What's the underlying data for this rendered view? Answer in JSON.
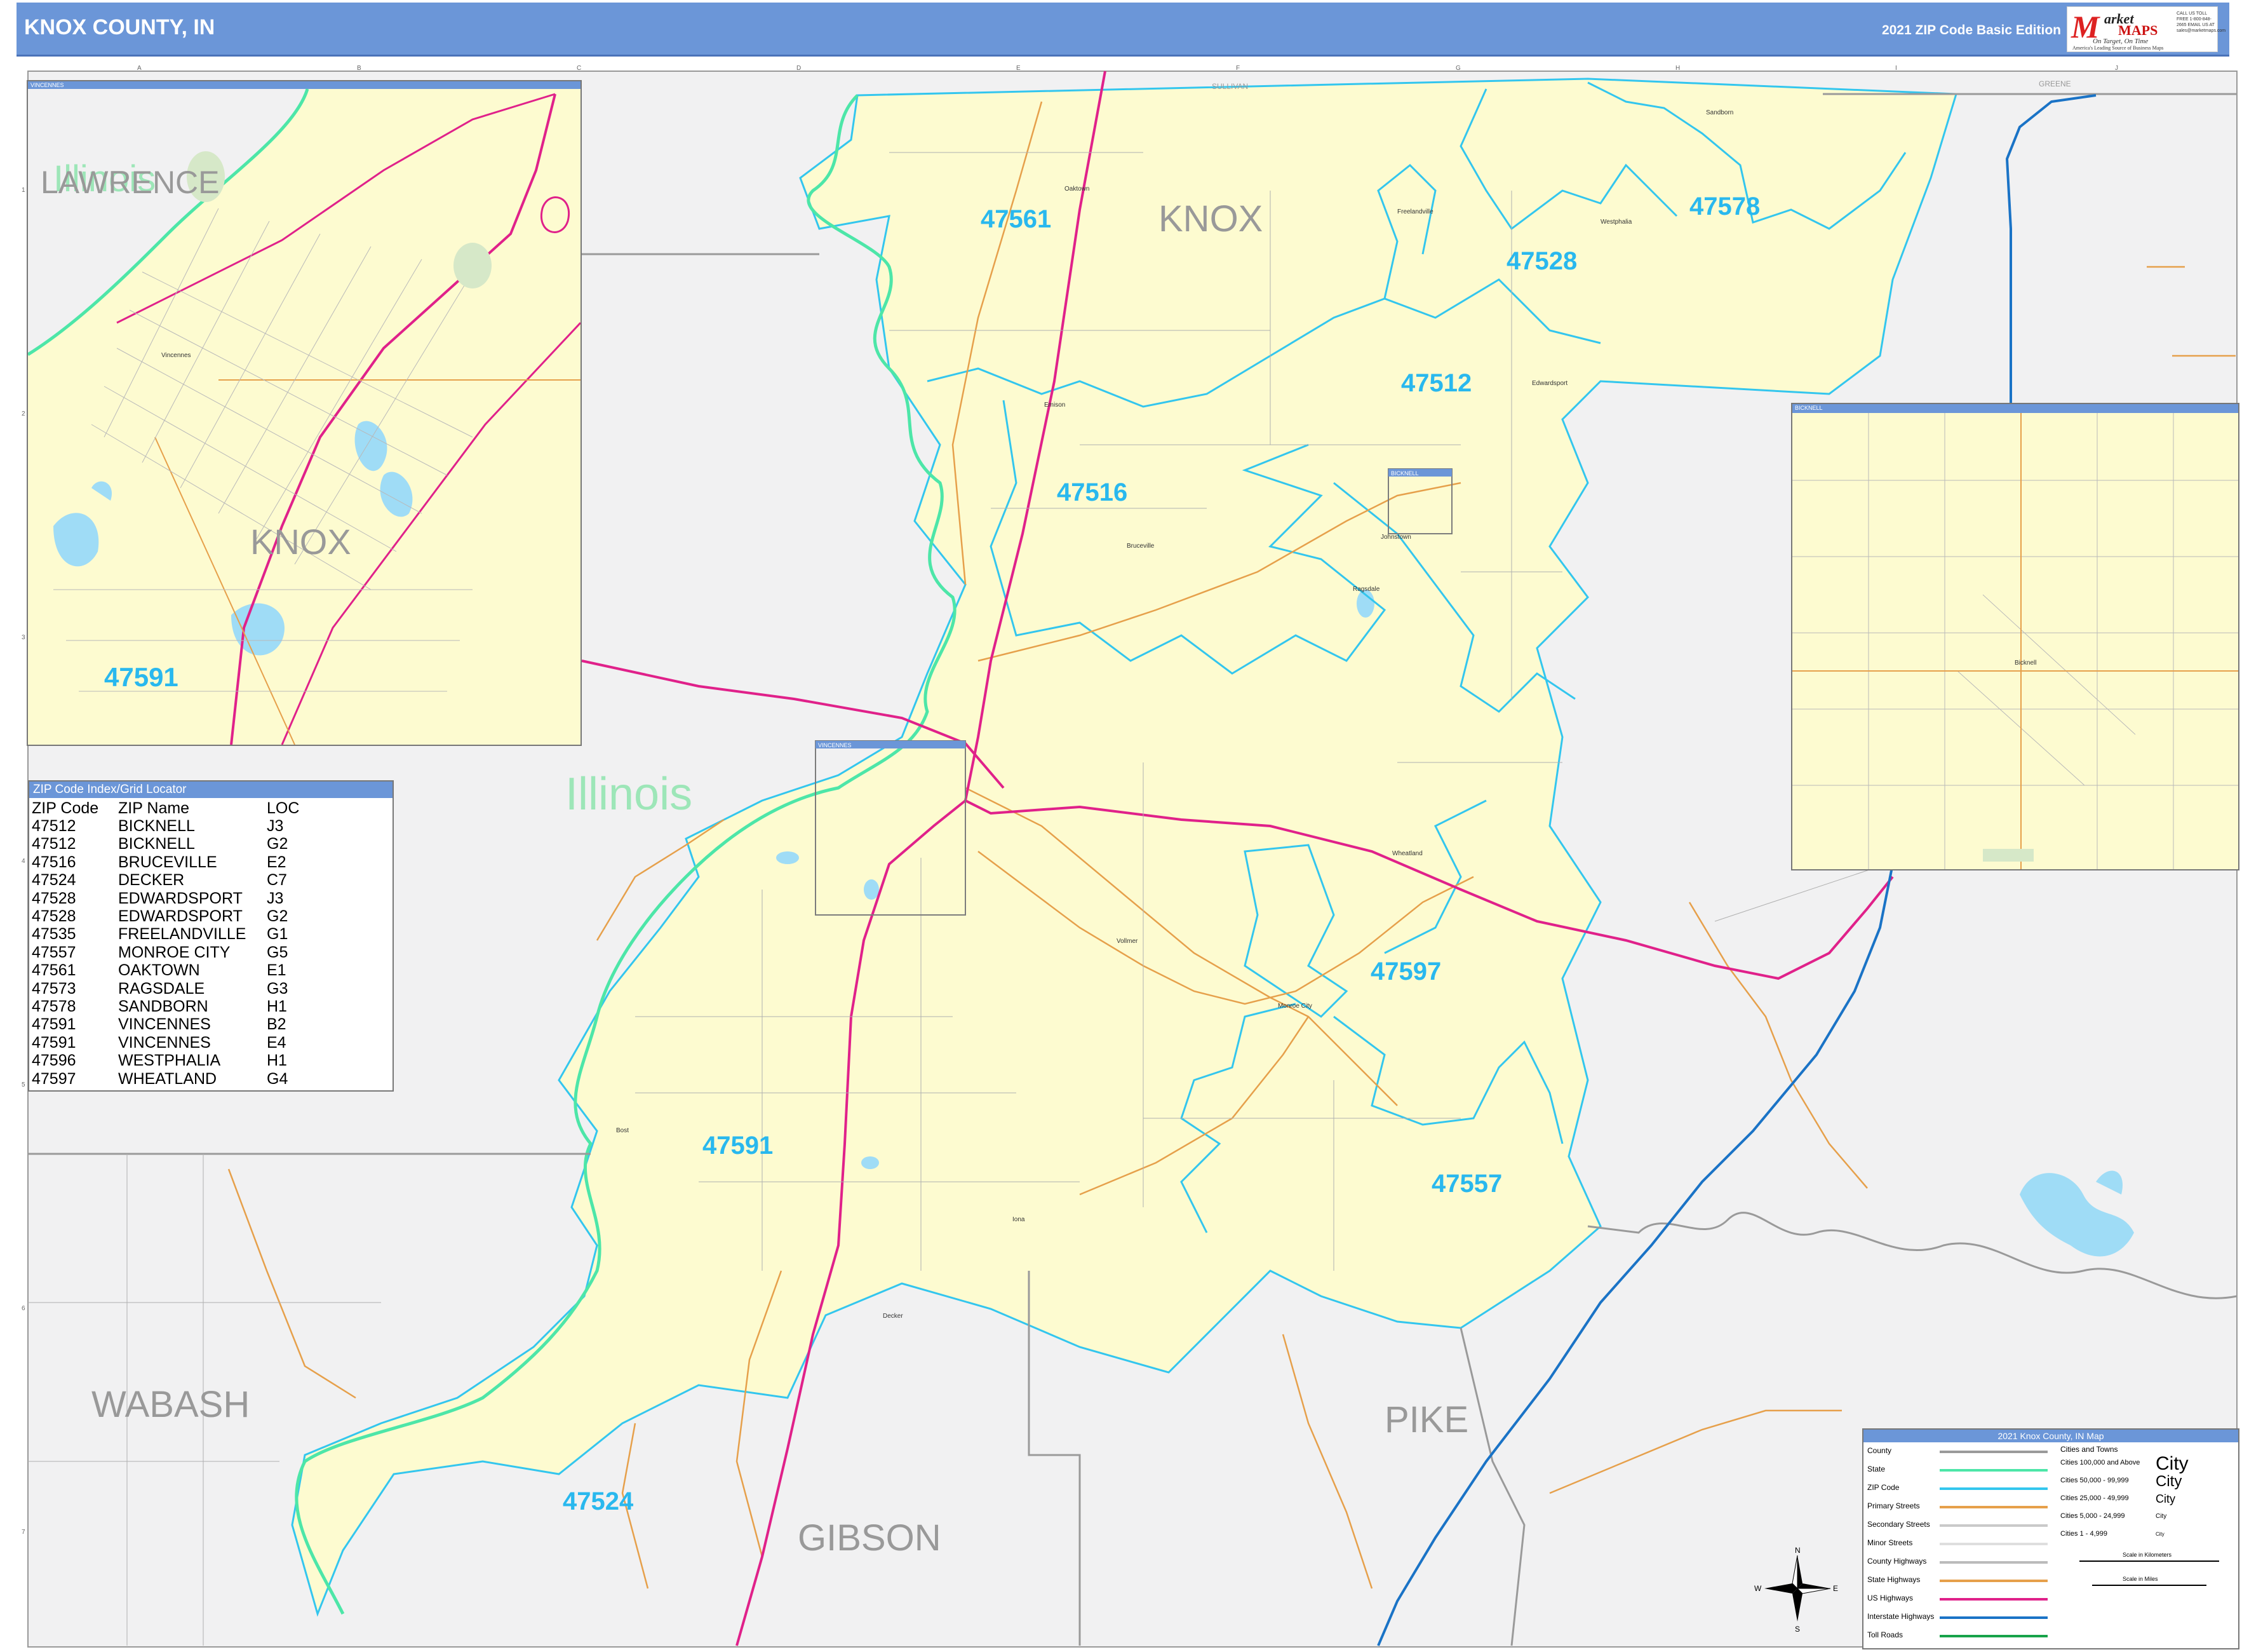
{
  "header": {
    "title": "KNOX COUNTY, IN",
    "edition": "2021 ZIP Code Basic Edition",
    "logo": {
      "m": "M",
      "market": "arket",
      "maps": "MAPS",
      "tagline": "On Target, On Time",
      "subtitle": "America's Leading Source of Business Maps",
      "contact": "CALL US TOLL FREE 1-800-848-2665 EMAIL US AT sales@marketmaps.com"
    }
  },
  "map": {
    "county_labels": {
      "knox": "KNOX",
      "wabash": "WABASH",
      "gibson": "GIBSON",
      "pike": "PIKE",
      "sullivan": "SULLIVAN",
      "greene": "GREENE",
      "lawrence": "LAWRENCE"
    },
    "state_labels": {
      "illinois": "Illinois"
    },
    "zip_labels": [
      {
        "zip": "47561"
      },
      {
        "zip": "47528"
      },
      {
        "zip": "47578"
      },
      {
        "zip": "47512"
      },
      {
        "zip": "47516"
      },
      {
        "zip": "47597"
      },
      {
        "zip": "47591"
      },
      {
        "zip": "47557"
      },
      {
        "zip": "47524"
      }
    ],
    "towns": {
      "oaktown": "Oaktown",
      "freelandville": "Freelandville",
      "westphalia": "Westphalia",
      "sandborn": "Sandborn",
      "edwardsport": "Edwardsport",
      "bicknell": "Bicknell",
      "emison": "Emison",
      "bruceville": "Bruceville",
      "johnstown": "Johnstown",
      "ragsdale": "Ragsdale",
      "wheatland": "Wheatland",
      "vollmer": "Vollmer",
      "monroe_city": "Monroe City",
      "bost": "Bost",
      "iona": "Iona",
      "decker": "Decker",
      "vincennes": "Vincennes"
    },
    "colors": {
      "county_fill": "#fdfbd0",
      "outside_fill": "#f1f1f2",
      "zip_boundary": "#33c6ee",
      "state_boundary": "#4de6a8",
      "us_highway": "#e0218a",
      "county_boundary": "#9a9a9a",
      "water": "#9fdcf6",
      "primary_street": "#e6a04b",
      "interstate": "#1a73c6",
      "header": "#6b96d8"
    }
  },
  "insets": {
    "vincennes": {
      "bar_label": "VINCENNES",
      "state_label": "Illinois",
      "county_label": "LAWRENCE",
      "knox_label": "KNOX",
      "zip_label": "47591",
      "town_label": "Vincennes"
    },
    "bicknell": {
      "bar_label": "BICKNELL",
      "town_label": "Bicknell"
    },
    "main_marker_vincennes": "VINCENNES",
    "main_marker_bicknell": "BICKNELL"
  },
  "zip_index": {
    "title": "ZIP Code Index/Grid Locator",
    "headers": [
      "ZIP Code",
      "ZIP Name",
      "LOC"
    ],
    "rows": [
      [
        "47512",
        "BICKNELL",
        "J3"
      ],
      [
        "47512",
        "BICKNELL",
        "G2"
      ],
      [
        "47516",
        "BRUCEVILLE",
        "E2"
      ],
      [
        "47524",
        "DECKER",
        "C7"
      ],
      [
        "47528",
        "EDWARDSPORT",
        "J3"
      ],
      [
        "47528",
        "EDWARDSPORT",
        "G2"
      ],
      [
        "47535",
        "FREELANDVILLE",
        "G1"
      ],
      [
        "47557",
        "MONROE CITY",
        "G5"
      ],
      [
        "47561",
        "OAKTOWN",
        "E1"
      ],
      [
        "47573",
        "RAGSDALE",
        "G3"
      ],
      [
        "47578",
        "SANDBORN",
        "H1"
      ],
      [
        "47591",
        "VINCENNES",
        "B2"
      ],
      [
        "47591",
        "VINCENNES",
        "E4"
      ],
      [
        "47596",
        "WESTPHALIA",
        "H1"
      ],
      [
        "47597",
        "WHEATLAND",
        "G4"
      ]
    ]
  },
  "legend": {
    "title": "2021 Knox County, IN Map",
    "left_items": [
      "County",
      "State",
      "ZIP Code",
      "Primary Streets",
      "Secondary Streets",
      "Minor Streets",
      "County Highways",
      "State Highways",
      "US Highways",
      "Interstate Highways",
      "Toll Roads"
    ],
    "right_header": "Cities and Towns",
    "city_sizes": [
      {
        "range": "Cities 100,000 and Above",
        "sample": "City"
      },
      {
        "range": "Cities 50,000 - 99,999",
        "sample": "City"
      },
      {
        "range": "Cities 25,000 - 49,999",
        "sample": "City"
      },
      {
        "range": "Cities 5,000 - 24,999",
        "sample": "City"
      },
      {
        "range": "Cities 1 - 4,999",
        "sample": "City"
      }
    ],
    "scale_km": "Scale in Kilometers",
    "scale_mi": "Scale in Miles",
    "compass": {
      "n": "N",
      "s": "S",
      "e": "E",
      "w": "W"
    }
  },
  "grid": {
    "columns": [
      "A",
      "B",
      "C",
      "D",
      "E",
      "F",
      "G",
      "H",
      "I",
      "J"
    ],
    "rows": [
      "1",
      "2",
      "3",
      "4",
      "5",
      "6",
      "7"
    ]
  }
}
